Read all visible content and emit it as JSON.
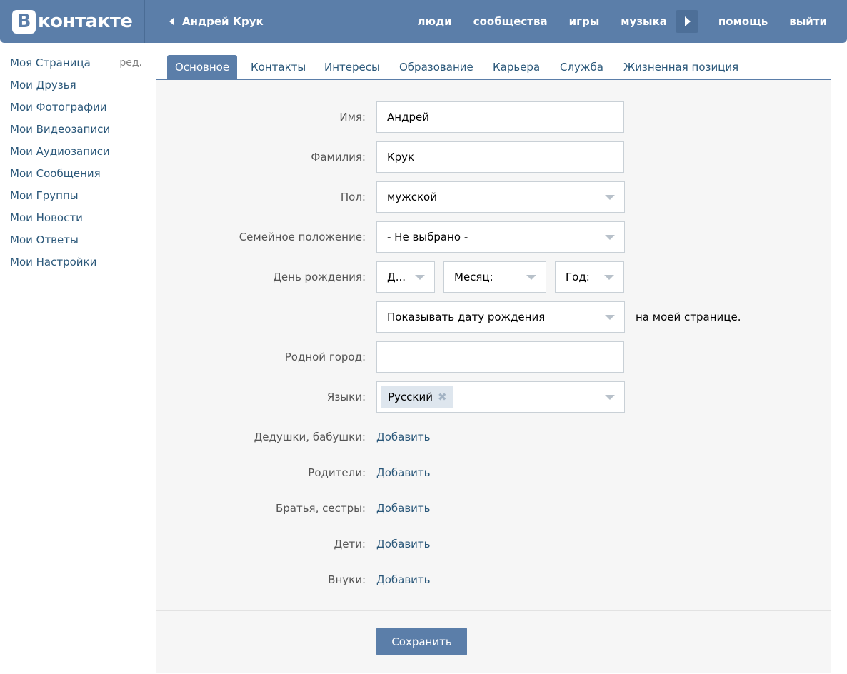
{
  "header": {
    "logo_mark": "В",
    "logo_text": "контакте",
    "back_label": "Андрей Крук",
    "nav": {
      "people": "люди",
      "communities": "сообщества",
      "games": "игры",
      "music": "музыка",
      "help": "помощь",
      "logout": "выйти"
    }
  },
  "sidebar": {
    "edit_label": "ред.",
    "items": [
      "Моя Страница",
      "Мои Друзья",
      "Мои Фотографии",
      "Мои Видеозаписи",
      "Мои Аудиозаписи",
      "Мои Сообщения",
      "Мои Группы",
      "Мои Новости",
      "Мои Ответы",
      "Мои Настройки"
    ]
  },
  "tabs": [
    "Основное",
    "Контакты",
    "Интересы",
    "Образование",
    "Карьера",
    "Служба",
    "Жизненная позиция"
  ],
  "active_tab": "Основное",
  "form": {
    "first_name": {
      "label": "Имя:",
      "value": "Андрей"
    },
    "last_name": {
      "label": "Фамилия:",
      "value": "Крук"
    },
    "gender": {
      "label": "Пол:",
      "value": "мужской"
    },
    "relationship": {
      "label": "Семейное положение:",
      "value": "- Не выбрано -"
    },
    "birthday": {
      "label": "День рождения:",
      "day": "Д...",
      "month": "Месяц:",
      "year": "Год:",
      "visibility": "Показывать дату рождения",
      "visibility_suffix": "на моей странице."
    },
    "hometown": {
      "label": "Родной город:",
      "value": ""
    },
    "languages": {
      "label": "Языки:",
      "tokens": [
        "Русский"
      ]
    },
    "relatives": [
      {
        "label": "Дедушки, бабушки:",
        "action": "Добавить"
      },
      {
        "label": "Родители:",
        "action": "Добавить"
      },
      {
        "label": "Братья, сестры:",
        "action": "Добавить"
      },
      {
        "label": "Дети:",
        "action": "Добавить"
      },
      {
        "label": "Внуки:",
        "action": "Добавить"
      }
    ],
    "save_label": "Сохранить"
  },
  "colors": {
    "header_bg": "#5b7ea9",
    "link": "#2b587a",
    "form_bg": "#f6f6f6",
    "token_bg": "#dee6ee"
  }
}
